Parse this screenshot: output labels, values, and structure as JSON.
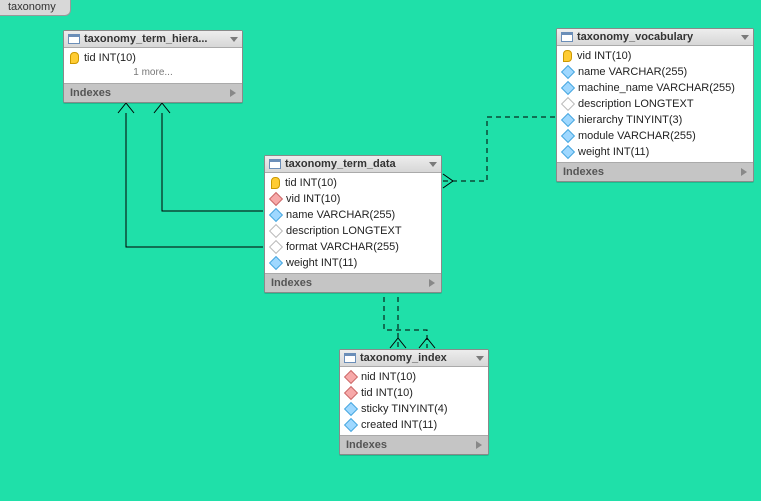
{
  "canvas": {
    "tab_label": "taxonomy"
  },
  "labels": {
    "indexes": "Indexes",
    "more": "1 more..."
  },
  "tables": {
    "hier": {
      "title": "taxonomy_term_hiera...",
      "cols": [
        {
          "key": "pk",
          "text": "tid INT(10)"
        }
      ],
      "has_more": true
    },
    "data": {
      "title": "taxonomy_term_data",
      "cols": [
        {
          "key": "pk",
          "text": "tid INT(10)"
        },
        {
          "key": "red",
          "text": "vid INT(10)"
        },
        {
          "key": "sky",
          "text": "name VARCHAR(255)"
        },
        {
          "key": "wh",
          "text": "description LONGTEXT"
        },
        {
          "key": "wh",
          "text": "format VARCHAR(255)"
        },
        {
          "key": "sky",
          "text": "weight INT(11)"
        }
      ]
    },
    "vocab": {
      "title": "taxonomy_vocabulary",
      "cols": [
        {
          "key": "pk",
          "text": "vid INT(10)"
        },
        {
          "key": "sky",
          "text": "name VARCHAR(255)"
        },
        {
          "key": "sky",
          "text": "machine_name VARCHAR(255)"
        },
        {
          "key": "wh",
          "text": "description LONGTEXT"
        },
        {
          "key": "sky",
          "text": "hierarchy TINYINT(3)"
        },
        {
          "key": "sky",
          "text": "module VARCHAR(255)"
        },
        {
          "key": "sky",
          "text": "weight INT(11)"
        }
      ]
    },
    "index": {
      "title": "taxonomy_index",
      "cols": [
        {
          "key": "red",
          "text": "nid INT(10)"
        },
        {
          "key": "red",
          "text": "tid INT(10)"
        },
        {
          "key": "sky",
          "text": "sticky TINYINT(4)"
        },
        {
          "key": "sky",
          "text": "created INT(11)"
        }
      ]
    }
  },
  "chart_data": {
    "type": "table",
    "title": "taxonomy ER diagram",
    "entities": [
      {
        "name": "taxonomy_term_hierarchy",
        "columns": [
          "tid INT(10)"
        ],
        "truncated_additional": 1
      },
      {
        "name": "taxonomy_term_data",
        "columns": [
          "tid INT(10)",
          "vid INT(10)",
          "name VARCHAR(255)",
          "description LONGTEXT",
          "format VARCHAR(255)",
          "weight INT(11)"
        ]
      },
      {
        "name": "taxonomy_vocabulary",
        "columns": [
          "vid INT(10)",
          "name VARCHAR(255)",
          "machine_name VARCHAR(255)",
          "description LONGTEXT",
          "hierarchy TINYINT(3)",
          "module VARCHAR(255)",
          "weight INT(11)"
        ]
      },
      {
        "name": "taxonomy_index",
        "columns": [
          "nid INT(10)",
          "tid INT(10)",
          "sticky TINYINT(4)",
          "created INT(11)"
        ]
      }
    ],
    "relationships": [
      {
        "from": "taxonomy_term_hierarchy.tid",
        "to": "taxonomy_term_data.tid",
        "style": "solid"
      },
      {
        "from": "taxonomy_term_hierarchy.parent",
        "to": "taxonomy_term_data.tid",
        "style": "solid"
      },
      {
        "from": "taxonomy_term_data.vid",
        "to": "taxonomy_vocabulary.vid",
        "style": "dashed"
      },
      {
        "from": "taxonomy_index.tid",
        "to": "taxonomy_term_data.tid",
        "style": "dashed"
      }
    ]
  }
}
